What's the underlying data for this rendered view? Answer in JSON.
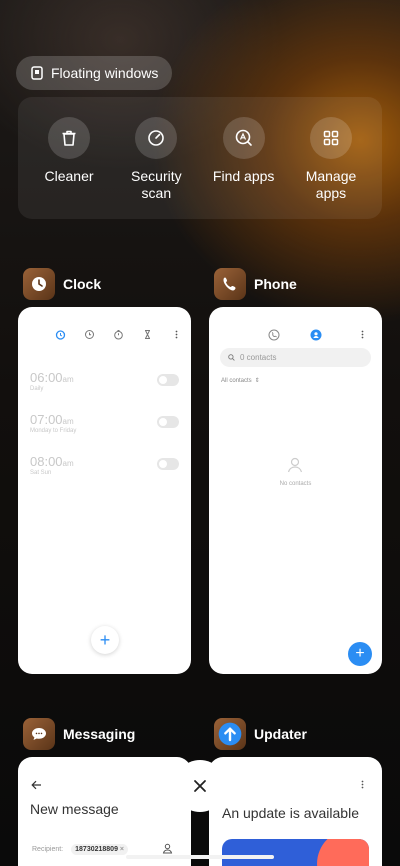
{
  "floating_windows": {
    "label": "Floating windows"
  },
  "quick_actions": [
    {
      "label": "Cleaner",
      "icon": "trash-icon"
    },
    {
      "label": "Security\nscan",
      "icon": "shield-scan-icon"
    },
    {
      "label": "Find apps",
      "icon": "app-search-icon"
    },
    {
      "label": "Manage\napps",
      "icon": "grid-icon"
    }
  ],
  "apps": {
    "clock": {
      "title": "Clock",
      "alarms": [
        {
          "time": "06:00",
          "ampm": "am",
          "sub": "Daily"
        },
        {
          "time": "07:00",
          "ampm": "am",
          "sub": "Monday to Friday"
        },
        {
          "time": "08:00",
          "ampm": "am",
          "sub": "Sat Sun"
        }
      ],
      "fab": "+"
    },
    "phone": {
      "title": "Phone",
      "search_placeholder": "0 contacts",
      "filter_label": "All contacts",
      "empty_label": "No contacts",
      "fab": "+"
    },
    "messaging": {
      "title": "Messaging",
      "heading": "New message",
      "recipient_label": "Recipient:",
      "recipient_value": "18730218809"
    },
    "updater": {
      "title": "Updater",
      "heading": "An update is available"
    }
  },
  "colors": {
    "accent_blue": "#2b8df3",
    "clock_icon_bg": "#7a4a2a",
    "phone_icon_bg": "#7a4a2a",
    "messaging_icon_bg": "#7a4a2a",
    "updater_icon_bg": "#2b8df3"
  },
  "close_button": {
    "icon": "close-icon"
  }
}
